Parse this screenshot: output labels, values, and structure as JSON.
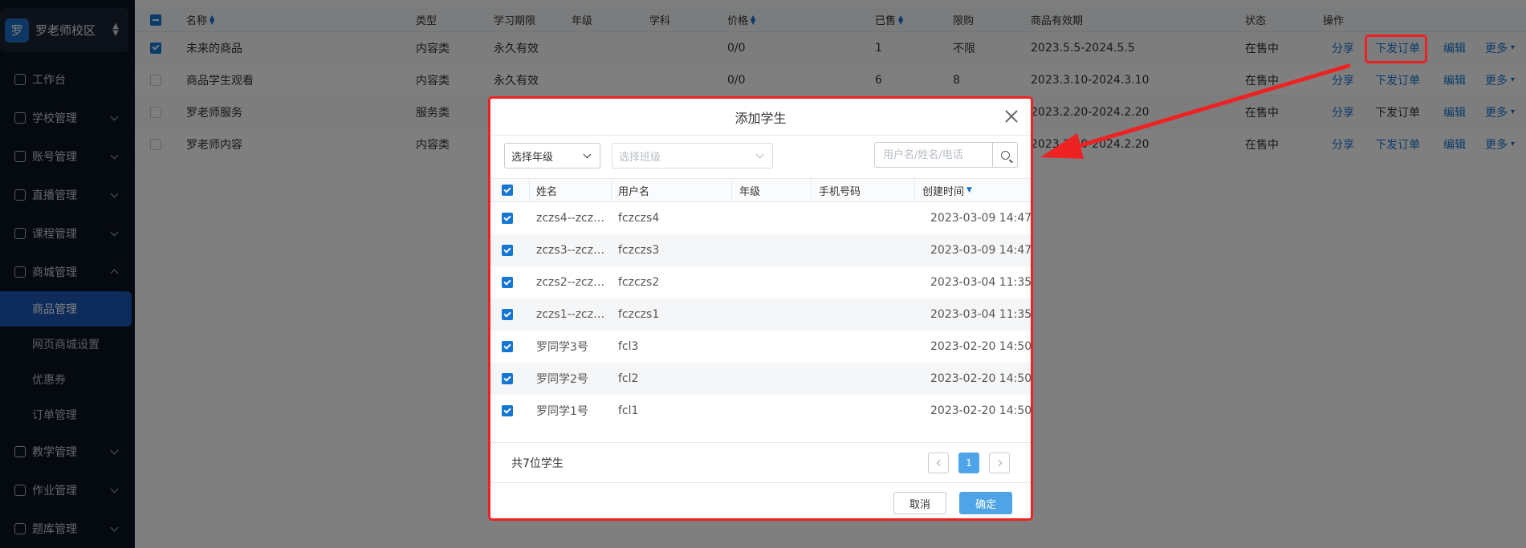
{
  "school": {
    "avatar": "罗",
    "name": "罗老师校区"
  },
  "sidebar": {
    "items": [
      {
        "label": "工作台",
        "icon": "dashboard-icon",
        "expandable": false
      },
      {
        "label": "学校管理",
        "icon": "school-icon",
        "expandable": true
      },
      {
        "label": "账号管理",
        "icon": "user-icon",
        "expandable": true
      },
      {
        "label": "直播管理",
        "icon": "live-icon",
        "expandable": true
      },
      {
        "label": "课程管理",
        "icon": "course-icon",
        "expandable": true
      },
      {
        "label": "商城管理",
        "icon": "shop-icon",
        "expandable": true,
        "expanded": true
      }
    ],
    "sub_items": [
      "商品管理",
      "网页商城设置",
      "优惠券",
      "订单管理"
    ],
    "active_sub": "商品管理",
    "items_after": [
      {
        "label": "教学管理",
        "icon": "teach-icon"
      },
      {
        "label": "作业管理",
        "icon": "homework-icon"
      },
      {
        "label": "题库管理",
        "icon": "question-bank-icon"
      }
    ]
  },
  "products_table": {
    "headers": {
      "name": "名称",
      "type": "类型",
      "period": "学习期限",
      "grade": "年级",
      "subject": "学科",
      "price": "价格",
      "sold": "已售",
      "limit": "限购",
      "validity": "商品有效期",
      "status": "状态",
      "actions": "操作"
    },
    "rows": [
      {
        "checked": true,
        "name": "未来的商品",
        "type": "内容类",
        "period": "永久有效",
        "price": "0/0",
        "sold": "1",
        "limit": "不限",
        "validity": "2023.5.5-2024.5.5",
        "status": "在售中"
      },
      {
        "checked": false,
        "name": "商品学生观看",
        "type": "内容类",
        "period": "永久有效",
        "price": "0/0",
        "sold": "6",
        "limit": "8",
        "validity": "2023.3.10-2024.3.10",
        "status": "在售中"
      },
      {
        "checked": false,
        "name": "罗老师服务",
        "type": "服务类",
        "period": "",
        "price": "",
        "sold": "",
        "limit": "",
        "validity": "2023.2.20-2024.2.20",
        "status": "在售中"
      },
      {
        "checked": false,
        "name": "罗老师内容",
        "type": "内容类",
        "period": "",
        "price": "",
        "sold": "",
        "limit": "",
        "validity": "2023.2.20-2024.2.20",
        "status": "在售中"
      }
    ],
    "actions": {
      "share": "分享",
      "order": "下发订单",
      "edit": "编辑",
      "more": "更多"
    }
  },
  "modal": {
    "title": "添加学生",
    "grade_select": "选择年级",
    "class_select": "选择班级",
    "search_placeholder": "用户名/姓名/电话",
    "headers": {
      "name": "姓名",
      "username": "用户名",
      "grade": "年级",
      "phone": "手机号码",
      "created": "创建时间"
    },
    "students": [
      {
        "name": "zczs4--zcz…",
        "username": "fczczs4",
        "grade": "",
        "phone": "",
        "created": "2023-03-09 14:47"
      },
      {
        "name": "zczs3--zcz…",
        "username": "fczczs3",
        "grade": "",
        "phone": "",
        "created": "2023-03-09 14:47"
      },
      {
        "name": "zczs2--zcz…",
        "username": "fczczs2",
        "grade": "",
        "phone": "",
        "created": "2023-03-04 11:35"
      },
      {
        "name": "zczs1--zcz…",
        "username": "fczczs1",
        "grade": "",
        "phone": "",
        "created": "2023-03-04 11:35"
      },
      {
        "name": "罗同学3号",
        "username": "fcl3",
        "grade": "",
        "phone": "",
        "created": "2023-02-20 14:50"
      },
      {
        "name": "罗同学2号",
        "username": "fcl2",
        "grade": "",
        "phone": "",
        "created": "2023-02-20 14:50"
      },
      {
        "name": "罗同学1号",
        "username": "fcl1",
        "grade": "",
        "phone": "",
        "created": "2023-02-20 14:50"
      }
    ],
    "total": "共7位学生",
    "current_page": "1",
    "cancel": "取消",
    "confirm": "确定"
  },
  "colors": {
    "primary": "#1677d2",
    "annotation": "#ee2222",
    "sidebar_bg": "#0b1220",
    "confirm_btn": "#4ea4e6"
  }
}
